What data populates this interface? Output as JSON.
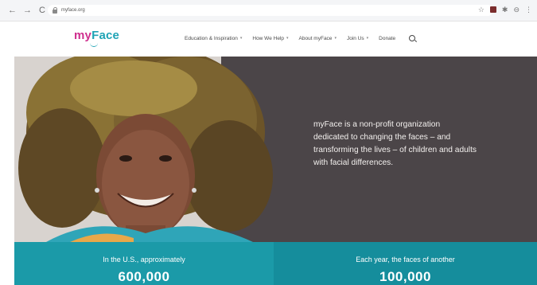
{
  "browser": {
    "url": "myface.org",
    "nav": {
      "back": "←",
      "forward": "→",
      "reload": "C"
    },
    "extensions": {
      "star": "☆",
      "puzzle": "✱",
      "profile": "⊖",
      "menu": "⋮"
    }
  },
  "header": {
    "logo_my": "my",
    "logo_face": "Face",
    "nav": [
      {
        "label": "Education & Inspiration",
        "has_dropdown": true
      },
      {
        "label": "How We Help",
        "has_dropdown": true
      },
      {
        "label": "About myFace",
        "has_dropdown": true
      },
      {
        "label": "Join Us",
        "has_dropdown": true
      },
      {
        "label": "Donate",
        "has_dropdown": false
      }
    ],
    "caret": "▾"
  },
  "hero": {
    "text": "myFace is a non-profit organization dedicated to changing the faces – and transforming the lives – of children and adults with facial differences."
  },
  "stats": [
    {
      "label": "In the U.S., approximately",
      "number": "600,000"
    },
    {
      "label": "Each year, the faces of another",
      "number": "100,000"
    }
  ],
  "colors": {
    "brand_pink": "#cf2f8e",
    "brand_teal": "#1fa3b5",
    "stat_left": "#1b9aa8",
    "stat_right": "#158d9c",
    "hero_dark": "#4b4548"
  }
}
